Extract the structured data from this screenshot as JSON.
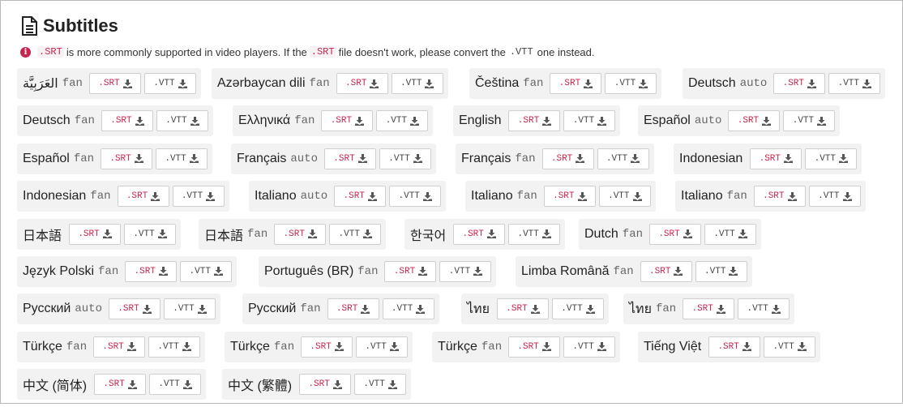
{
  "header": {
    "title": "Subtitles",
    "icon": "document-icon"
  },
  "note": {
    "icon": "info-icon",
    "code1": ".SRT",
    "text1": "is more commonly supported in video players. If the",
    "code2": ".SRT",
    "text2": "file doesn't work, please convert the",
    "code3": ".VTT",
    "text3": "one instead."
  },
  "buttons": {
    "srt_label": ".SRT",
    "vtt_label": ".VTT",
    "icon": "download-icon"
  },
  "colors": {
    "accent": "#c7254e",
    "item_bg": "#f2f2f2"
  },
  "rows": [
    [
      {
        "lang": "العَرَبِيَّة",
        "kind": "fan"
      },
      {
        "lang": "Azərbaycan dili",
        "kind": "fan"
      },
      {
        "lang": "Čeština",
        "kind": "fan"
      },
      {
        "lang": "Deutsch",
        "kind": "auto"
      }
    ],
    [
      {
        "lang": "Deutsch",
        "kind": "fan"
      },
      {
        "lang": "Ελληνικά",
        "kind": "fan"
      },
      {
        "lang": "English",
        "kind": ""
      },
      {
        "lang": "Español",
        "kind": "auto"
      }
    ],
    [
      {
        "lang": "Español",
        "kind": "fan"
      },
      {
        "lang": "Français",
        "kind": "auto"
      },
      {
        "lang": "Français",
        "kind": "fan"
      },
      {
        "lang": "Indonesian",
        "kind": ""
      }
    ],
    [
      {
        "lang": "Indonesian",
        "kind": "fan"
      },
      {
        "lang": "Italiano",
        "kind": "auto"
      },
      {
        "lang": "Italiano",
        "kind": "fan"
      },
      {
        "lang": "Italiano",
        "kind": "fan"
      }
    ],
    [
      {
        "lang": "日本語",
        "kind": ""
      },
      {
        "lang": "日本語",
        "kind": "fan"
      },
      {
        "lang": "한국어",
        "kind": ""
      },
      {
        "lang": "Dutch",
        "kind": "fan"
      }
    ],
    [
      {
        "lang": "Język Polski",
        "kind": "fan"
      },
      {
        "lang": "Português (BR)",
        "kind": "fan"
      },
      {
        "lang": "Limba Română",
        "kind": "fan"
      }
    ],
    [
      {
        "lang": "Русский",
        "kind": "auto"
      },
      {
        "lang": "Русский",
        "kind": "fan"
      },
      {
        "lang": "ไทย",
        "kind": ""
      },
      {
        "lang": "ไทย",
        "kind": "fan"
      }
    ],
    [
      {
        "lang": "Türkçe",
        "kind": "fan"
      },
      {
        "lang": "Türkçe",
        "kind": "fan"
      },
      {
        "lang": "Türkçe",
        "kind": "fan"
      },
      {
        "lang": "Tiếng Việt",
        "kind": ""
      }
    ],
    [
      {
        "lang": "中文 (简体)",
        "kind": ""
      },
      {
        "lang": "中文 (繁體)",
        "kind": ""
      }
    ]
  ]
}
